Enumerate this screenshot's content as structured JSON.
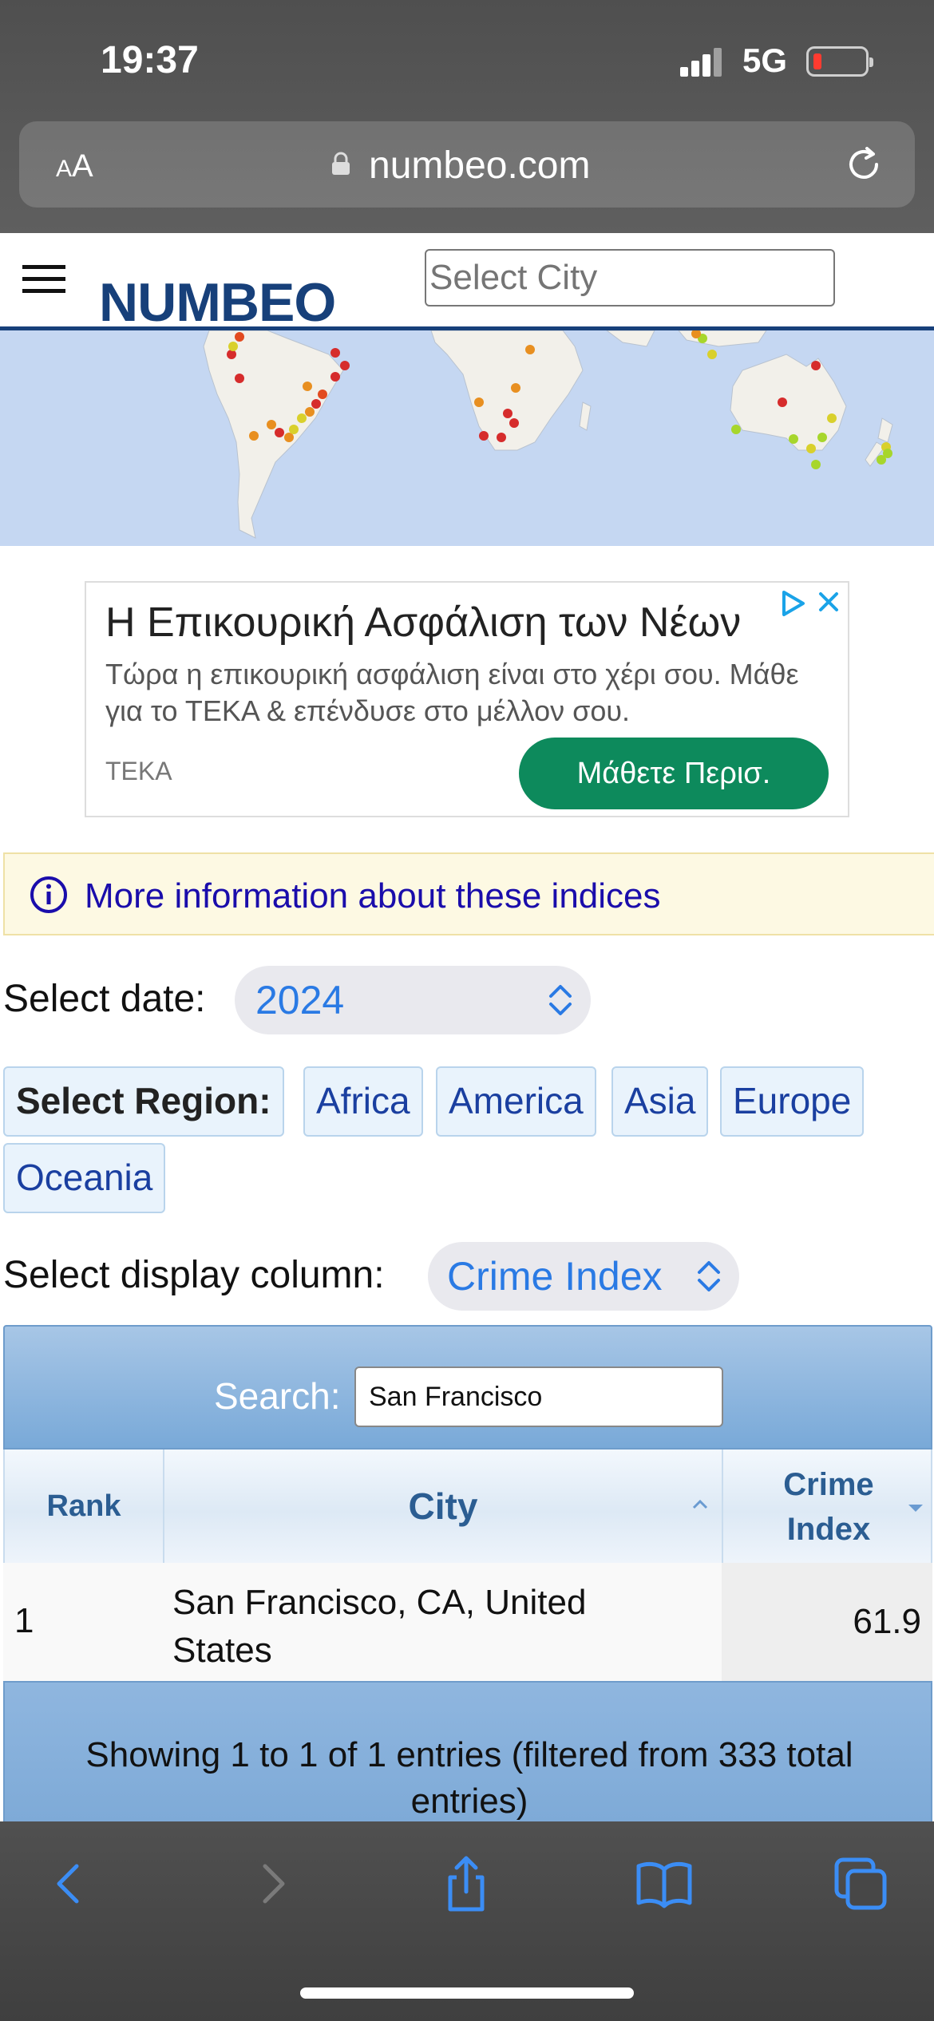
{
  "status_bar": {
    "time": "19:37",
    "network": "5G"
  },
  "browser": {
    "text_size_label_small": "A",
    "text_size_label_large": "A",
    "url": "numbeo.com"
  },
  "site": {
    "logo": "NUMBEO",
    "city_select_placeholder": "Select City"
  },
  "ad": {
    "title": "Η Επικουρική Ασφάλιση των Νέων",
    "description": "Τώρα η επικουρική ασφάλιση είναι στο χέρι σου. Μάθε για το ΤΕΚΑ & επένδυσε στο μέλλον σου.",
    "brand": "ΤΕΚΑ",
    "cta": "Μάθετε Περισ."
  },
  "info": {
    "link_text": "More information about these indices"
  },
  "date": {
    "label": "Select date:",
    "selected": "2024"
  },
  "region": {
    "label": "Select Region:",
    "options": [
      "Africa",
      "America",
      "Asia",
      "Europe",
      "Oceania"
    ]
  },
  "column": {
    "label": "Select display column:",
    "selected": "Crime Index"
  },
  "table": {
    "search_label": "Search:",
    "search_value": "San Francisco",
    "headers": {
      "rank": "Rank",
      "city": "City",
      "index_line1": "Crime",
      "index_line2": "Index"
    },
    "rows": [
      {
        "rank": "1",
        "city": "San Francisco, CA, United States",
        "value": "61.9"
      }
    ],
    "footer": "Showing 1 to 1 of 1 entries (filtered from 333 total entries)"
  },
  "colors": {
    "brand": "#17407a",
    "link": "#1a0dab",
    "ad_button": "#0d8a5c",
    "ios_blue": "#2a7ae4"
  },
  "icons": [
    "hamburger-icon",
    "lock-icon",
    "reload-icon",
    "ad-choices-icon",
    "close-icon",
    "info-icon",
    "updown-icon",
    "sort-up-icon",
    "sort-down-icon",
    "back-icon",
    "forward-icon",
    "share-icon",
    "bookmarks-icon",
    "tabs-icon"
  ]
}
